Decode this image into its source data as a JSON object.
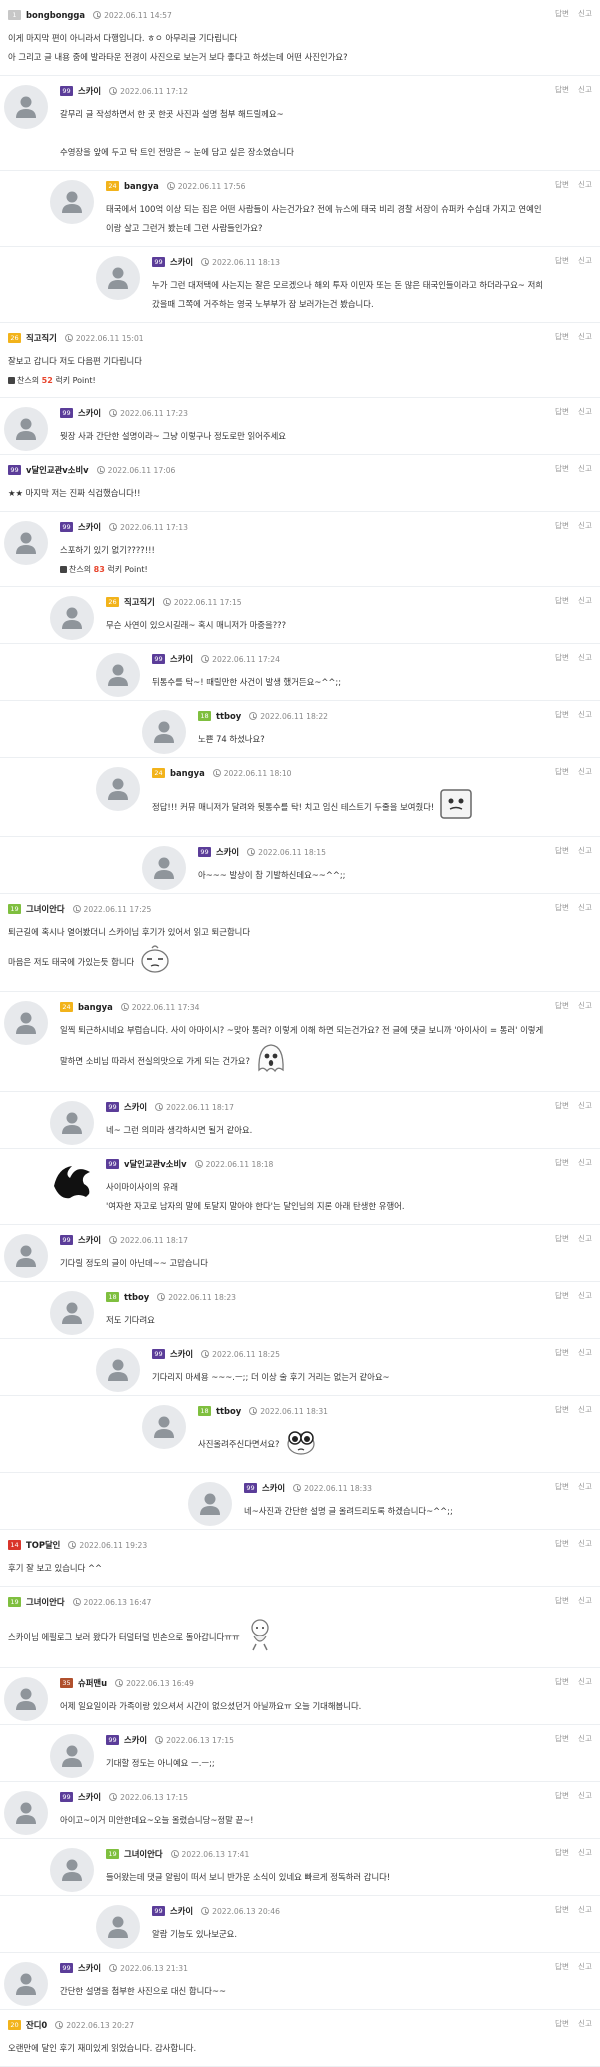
{
  "colors": {
    "level_gray": "#c7c7c7",
    "level_purple": "#5b3d99",
    "level_yellow": "#f2b31b",
    "level_green": "#7fbf3f",
    "level_red": "#d9352b",
    "level_brown": "#b0502d",
    "point_red": "#e8442c"
  },
  "actions": {
    "reply": "답변",
    "report": "신고"
  },
  "point_label": {
    "prefix": "찬스의",
    "suffix": "럭키 Point!"
  },
  "comments": [
    {
      "depth": 0,
      "avatar": false,
      "level": "1",
      "level_color": "gray",
      "name": "bongbongga",
      "time": "2022.06.11 14:57",
      "text": "이게 마지막 편이 아니라서 다행입니다. ㅎㅇ 아무리글 기다립니다\n아 그리고 글 내용 중에 발라타운 전경이 사진으로 보는거 보다 좋다고 하셨는데 어떤 사진인가요?"
    },
    {
      "depth": 0,
      "avatar": true,
      "level": "99",
      "level_color": "purple",
      "name": "스카이",
      "time": "2022.06.11 17:12",
      "text": "갈무리 글 작성하면서 한 곳 한곳 사진과 설명 첨부 해드릴께요~\n\n수영장을 앞에 두고 탁 트인 전망은 ~ 눈에 담고 싶은 장소였습니다"
    },
    {
      "depth": 1,
      "avatar": true,
      "level": "24",
      "level_color": "yellow",
      "name": "bangya",
      "time": "2022.06.11 17:56",
      "text": "태국에서 100억 이상 되는 집은 어떤 사람들이 사는건가요? 전에 뉴스에 태국 비리 경찰 서장이 슈퍼카 수십대 가지고 연예인\n이랑 살고 그런거 봤는데 그런 사람들인가요?"
    },
    {
      "depth": 2,
      "avatar": true,
      "level": "99",
      "level_color": "purple",
      "name": "스카이",
      "time": "2022.06.11 18:13",
      "text": "누가 그런 대저택에 사는지는 잘은 모르겠으나 해외 투자 이민자 또는 돈 많은 태국인들이라고 하더라구요~ 저희\n갔을때 그쪽에 거주하는 영국 노부부가 잠 보러가는건 봤습니다."
    },
    {
      "depth": 0,
      "avatar": false,
      "level": "26",
      "level_color": "yellow",
      "name": "직고직기",
      "time": "2022.06.11 15:01",
      "text": "잘보고 갑니다 저도 다음편 기다립니다",
      "point": "52"
    },
    {
      "depth": 0,
      "avatar": true,
      "level": "99",
      "level_color": "purple",
      "name": "스카이",
      "time": "2022.06.11 17:23",
      "text": "뭣장 사과 간단한 설명이라~ 그냥 이렇구나 정도로만 읽어주세요"
    },
    {
      "depth": 0,
      "avatar": false,
      "level": "99",
      "level_color": "purple",
      "name": "v달인교관v소비v",
      "time": "2022.06.11 17:06",
      "text": "★★ 마지막 저는 진짜 식겁했습니다!!"
    },
    {
      "depth": 0,
      "avatar": true,
      "level": "99",
      "level_color": "purple",
      "name": "스카이",
      "time": "2022.06.11 17:13",
      "text": "스포하기 있기 없기????!!!",
      "point": "83"
    },
    {
      "depth": 1,
      "avatar": true,
      "level": "26",
      "level_color": "yellow",
      "name": "직고직기",
      "time": "2022.06.11 17:15",
      "text": "무슨 사연이 있으시길래~ 혹시 매니저가 마중을???"
    },
    {
      "depth": 2,
      "avatar": true,
      "level": "99",
      "level_color": "purple",
      "name": "스카이",
      "time": "2022.06.11 17:24",
      "text": "뒤통수를 탁~! 때릴만한 사건이 발생 했거든요~^^;;"
    },
    {
      "depth": 3,
      "avatar": true,
      "level": "18",
      "level_color": "green",
      "name": "ttboy",
      "time": "2022.06.11 18:22",
      "text": "노쁜 74 하셨나요?"
    },
    {
      "depth": 2,
      "avatar": true,
      "level": "24",
      "level_color": "yellow",
      "name": "bangya",
      "time": "2022.06.11 18:10",
      "text": "정답!!! 커뮤 매니저가 달려와 뒷통수를 탁! 치고 임신 테스트기 두줄을 보여줬다!",
      "sticker": "sticker-box"
    },
    {
      "depth": 3,
      "avatar": true,
      "level": "99",
      "level_color": "purple",
      "name": "스카이",
      "time": "2022.06.11 18:15",
      "text": "아~~~ 발상이 참 기발하신데요~~^^;;"
    },
    {
      "depth": 0,
      "avatar": false,
      "level": "19",
      "level_color": "green",
      "name": "그녀이안다",
      "time": "2022.06.11 17:25",
      "text": "퇴근길에 혹시나 열어봤더니 스카이님 후기가 있어서 읽고 퇴근합니다\n마음은 저도 태국에 가있는듯 합니다",
      "sticker": "sticker-face"
    },
    {
      "depth": 0,
      "avatar": true,
      "level": "24",
      "level_color": "yellow",
      "name": "bangya",
      "time": "2022.06.11 17:34",
      "text": "일찍 퇴근하시네요 부럽습니다. 사이 아마이시? ~맞아 통러? 이렇게 이해 하면 되는건가요? 전 글에 댓글 보니까 '아이사이 = 통러' 이렇게\n말하면 소비님 따라서 전실의맛으로 가게 되는 건가요?",
      "sticker": "sticker-ghost"
    },
    {
      "depth": 1,
      "avatar": true,
      "level": "99",
      "level_color": "purple",
      "name": "스카이",
      "time": "2022.06.11 18:17",
      "text": "네~ 그런 의미라 생각하시면 될거 같아요."
    },
    {
      "depth": 1,
      "avatar": true,
      "avatar_style": "black",
      "level": "99",
      "level_color": "purple",
      "name": "v달인교관v소비v",
      "time": "2022.06.11 18:18",
      "text": "사이마이사이의 유래\n'여자한 자고로 남자의 말에 토달지 말아야 한다'는 달인님의 지론 아래 탄생한 유행어."
    },
    {
      "depth": 0,
      "avatar": true,
      "level": "99",
      "level_color": "purple",
      "name": "스카이",
      "time": "2022.06.11 18:17",
      "text": "기다릴 정도의 글이 아닌데~~ 고맙습니다"
    },
    {
      "depth": 1,
      "avatar": true,
      "level": "18",
      "level_color": "green",
      "name": "ttboy",
      "time": "2022.06.11 18:23",
      "text": "저도 기다려요"
    },
    {
      "depth": 2,
      "avatar": true,
      "level": "99",
      "level_color": "purple",
      "name": "스카이",
      "time": "2022.06.11 18:25",
      "text": "기다리지 마세용 ~~~.ㅡ;; 더 이상 술 후기 거리는 없는거 같아요~"
    },
    {
      "depth": 3,
      "avatar": true,
      "level": "18",
      "level_color": "green",
      "name": "ttboy",
      "time": "2022.06.11 18:31",
      "text": "사진올려주신다면서요?",
      "sticker": "sticker-eyes"
    },
    {
      "depth": 4,
      "avatar": true,
      "level": "99",
      "level_color": "purple",
      "name": "스카이",
      "time": "2022.06.11 18:33",
      "text": "네~사진과 간단한 설명 글 올려드리도록 하겠습니다~^^;;"
    },
    {
      "depth": 0,
      "avatar": false,
      "level": "14",
      "level_color": "red",
      "name": "TOP달인",
      "time": "2022.06.11 19:23",
      "text": "후기 잘 보고 있습니다 ^^"
    },
    {
      "depth": 0,
      "avatar": false,
      "level": "19",
      "level_color": "green",
      "name": "그녀이안다",
      "time": "2022.06.13 16:47",
      "text": "스카이님 에필로그 보러 왔다가 터덜터덜 빈손으로 돌아갑니다ㅠㅠ",
      "sticker": "sticker-walk"
    },
    {
      "depth": 0,
      "avatar": true,
      "level": "35",
      "level_color": "brown",
      "name": "슈퍼맨u",
      "time": "2022.06.13 16:49",
      "text": "어제 일요일이라 가족이랑 있으셔서 시간이 없으셨던거 아닐까요ㅠ 오늘 기대해봅니다."
    },
    {
      "depth": 1,
      "avatar": true,
      "level": "99",
      "level_color": "purple",
      "name": "스카이",
      "time": "2022.06.13 17:15",
      "text": "기대할 정도는 아니예요 ㅡ.ㅡ;;"
    },
    {
      "depth": 0,
      "avatar": true,
      "level": "99",
      "level_color": "purple",
      "name": "스카이",
      "time": "2022.06.13 17:15",
      "text": "아이고~이거 미안한데요~오늘 올렸습니당~정말 끝~!"
    },
    {
      "depth": 1,
      "avatar": true,
      "level": "19",
      "level_color": "green",
      "name": "그녀이안다",
      "time": "2022.06.13 17:41",
      "text": "들어왔는데 댓글 알림이 떠서 보니 반가운 소식이 있네요 빠르게 정독하러 갑니다!"
    },
    {
      "depth": 2,
      "avatar": true,
      "level": "99",
      "level_color": "purple",
      "name": "스카이",
      "time": "2022.06.13 20:46",
      "text": "알람 기능도 있나보군요."
    },
    {
      "depth": 0,
      "avatar": true,
      "level": "99",
      "level_color": "purple",
      "name": "스카이",
      "time": "2022.06.13 21:31",
      "text": "간단한 설명을 첨부한 사진으로 대신 합니다~~"
    },
    {
      "depth": 0,
      "avatar": false,
      "level": "20",
      "level_color": "yellow",
      "name": "잔디0",
      "time": "2022.06.13 20:27",
      "text": "오랜만에 달인 후기 재미있게 읽었습니다. 감사합니다."
    },
    {
      "depth": 0,
      "avatar": true,
      "level": "99",
      "level_color": "purple",
      "name": "스카이",
      "time": "2022.06.13 20:47",
      "text": "재미 있게 읽으셨다니 다행입니다."
    }
  ]
}
